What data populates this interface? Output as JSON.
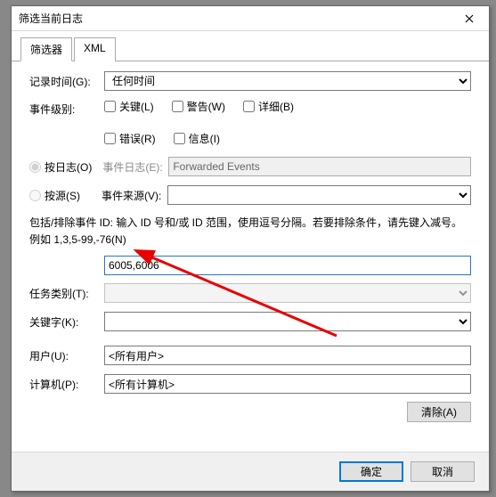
{
  "title": "筛选当前日志",
  "tabs": {
    "filter": "筛选器",
    "xml": "XML"
  },
  "labels": {
    "logged": "记录时间(G):",
    "level": "事件级别:",
    "byLog": "按日志(O)",
    "bySource": "按源(S)",
    "eventLog": "事件日志(E):",
    "eventSource": "事件来源(V):",
    "help": "包括/排除事件 ID: 输入 ID 号和/或 ID 范围，使用逗号分隔。若要排除条件，请先键入减号。例如 1,3,5-99,-76(N)",
    "taskCat": "任务类别(T):",
    "keywords": "关键字(K):",
    "user": "用户(U):",
    "computer": "计算机(P):",
    "clear": "清除(A)",
    "ok": "确定",
    "cancel": "取消"
  },
  "fields": {
    "loggedValue": "任何时间",
    "eventLogValue": "Forwarded Events",
    "eventSourceValue": "",
    "idValue": "6005,6006",
    "taskValue": "",
    "keywordValue": "",
    "userValue": "<所有用户>",
    "computerValue": "<所有计算机>"
  },
  "checks": {
    "critical": "关键(L)",
    "warning": "警告(W)",
    "verbose": "详细(B)",
    "error": "错误(R)",
    "info": "信息(I)"
  }
}
